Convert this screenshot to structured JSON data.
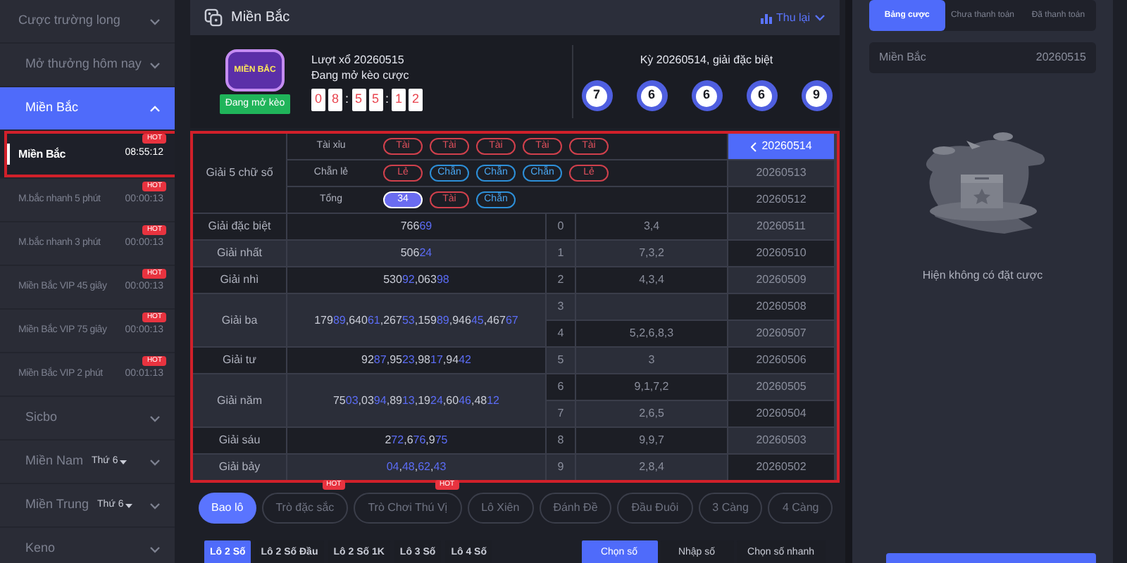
{
  "sidebar": {
    "items": [
      {
        "label": "Cược trường long",
        "expanded": false
      },
      {
        "label": "Mở thưởng hôm nay",
        "expanded": false
      },
      {
        "label": "Miền Bắc",
        "expanded": true,
        "children": [
          {
            "label": "Miền Bắc",
            "time": "08:55:12",
            "badge": "HOT",
            "selected": true,
            "highlighted": true
          },
          {
            "label": "M.bắc nhanh 5 phút",
            "time": "00:00:13",
            "badge": "HOT",
            "selected": false,
            "highlighted": false
          },
          {
            "label": "M.bắc nhanh 3 phút",
            "time": "00:00:13",
            "badge": "HOT",
            "selected": false,
            "highlighted": false
          },
          {
            "label": "Miền Bắc VIP 45 giây",
            "time": "00:00:13",
            "badge": "HOT",
            "selected": false,
            "highlighted": false
          },
          {
            "label": "Miền Bắc VIP 75 giây",
            "time": "00:00:13",
            "badge": "HOT",
            "selected": false,
            "highlighted": false
          },
          {
            "label": "Miền Bắc VIP 2 phút",
            "time": "00:01:13",
            "badge": "HOT",
            "selected": false,
            "highlighted": false
          }
        ]
      },
      {
        "label": "Sicbo",
        "expanded": false
      },
      {
        "label": "Miền Nam",
        "day": "Thứ 6",
        "expanded": false
      },
      {
        "label": "Miền Trung",
        "day": "Thứ 6",
        "expanded": false
      },
      {
        "label": "Keno",
        "expanded": false
      }
    ]
  },
  "header": {
    "title": "Miền Bắc",
    "action": "Thu lại"
  },
  "draw": {
    "logo_text": "MIỀN BẮC",
    "status_badge": "Đang mở kèo",
    "round": "Lượt xổ 20260515",
    "state": "Đang mở kèo cược",
    "countdown": [
      "0",
      "8",
      ":",
      "5",
      "5",
      ":",
      "1",
      "2"
    ],
    "last_title": "Kỳ 20260514, giải đặc biệt",
    "balls": [
      "7",
      "6",
      "6",
      "6",
      "9"
    ]
  },
  "results": {
    "highlighted": true,
    "title": "Giải 5 chữ số",
    "separator": ",",
    "header_rows": [
      {
        "label": "Tài xỉu",
        "pills": [
          {
            "text": "Tài",
            "kind": "over"
          },
          {
            "text": "Tài",
            "kind": "over"
          },
          {
            "text": "Tài",
            "kind": "over"
          },
          {
            "text": "Tài",
            "kind": "over"
          },
          {
            "text": "Tài",
            "kind": "over"
          }
        ]
      },
      {
        "label": "Chẵn lẻ",
        "pills": [
          {
            "text": "Lẻ",
            "kind": "odd"
          },
          {
            "text": "Chẵn",
            "kind": "even"
          },
          {
            "text": "Chẵn",
            "kind": "even"
          },
          {
            "text": "Chẵn",
            "kind": "even"
          },
          {
            "text": "Lẻ",
            "kind": "odd"
          }
        ]
      },
      {
        "label": "Tổng",
        "pills": [
          {
            "text": "34",
            "kind": "total"
          },
          {
            "text": "Tài",
            "kind": "over"
          },
          {
            "text": "Chẵn",
            "kind": "even"
          }
        ]
      }
    ],
    "prizes": [
      {
        "label": "Giải đặc biệt",
        "numbers": [
          {
            "head": "766",
            "tail": "69"
          }
        ]
      },
      {
        "label": "Giải nhất",
        "numbers": [
          {
            "head": "506",
            "tail": "24"
          }
        ]
      },
      {
        "label": "Giải nhì",
        "numbers": [
          {
            "head": "530",
            "tail": "92"
          },
          {
            "head": "063",
            "tail": "98"
          }
        ]
      },
      {
        "label": "Giải ba",
        "numbers": [
          {
            "head": "179",
            "tail": "89"
          },
          {
            "head": "640",
            "tail": "61"
          },
          {
            "head": "267",
            "tail": "53"
          },
          {
            "head": "159",
            "tail": "89"
          },
          {
            "head": "946",
            "tail": "45"
          },
          {
            "head": "467",
            "tail": "67"
          }
        ]
      },
      {
        "label": "Giải tư",
        "numbers": [
          {
            "head": "92",
            "tail": "87"
          },
          {
            "head": "95",
            "tail": "23"
          },
          {
            "head": "98",
            "tail": "17"
          },
          {
            "head": "94",
            "tail": "42"
          }
        ]
      },
      {
        "label": "Giải năm",
        "numbers": [
          {
            "head": "75",
            "tail": "03"
          },
          {
            "head": "03",
            "tail": "94"
          },
          {
            "head": "89",
            "tail": "13"
          },
          {
            "head": "19",
            "tail": "24"
          },
          {
            "head": "60",
            "tail": "46"
          },
          {
            "head": "48",
            "tail": "12"
          }
        ]
      },
      {
        "label": "Giải sáu",
        "numbers": [
          {
            "head": "2",
            "tail": "72"
          },
          {
            "head": "6",
            "tail": "76"
          },
          {
            "head": "9",
            "tail": "75"
          }
        ]
      },
      {
        "label": "Giải bảy",
        "numbers": [
          {
            "tail": "04"
          },
          {
            "tail": "48"
          },
          {
            "tail": "62"
          },
          {
            "tail": "43"
          }
        ]
      }
    ],
    "heads": [
      {
        "digit": "0",
        "tails": "3,4"
      },
      {
        "digit": "1",
        "tails": "7,3,2"
      },
      {
        "digit": "2",
        "tails": "4,3,4"
      },
      {
        "digit": "3"
      },
      {
        "digit": "4",
        "tails": "5,2,6,8,3"
      },
      {
        "digit": "5",
        "tails": "3"
      },
      {
        "digit": "6",
        "tails": "9,1,7,2"
      },
      {
        "digit": "7",
        "tails": "2,6,5"
      },
      {
        "digit": "8",
        "tails": "9,9,7"
      },
      {
        "digit": "9",
        "tails": "2,8,4"
      }
    ],
    "periods": [
      {
        "label": "20260514",
        "selected": true
      },
      {
        "label": "20260513",
        "selected": false
      },
      {
        "label": "20260512",
        "selected": false
      },
      {
        "label": "20260511",
        "selected": false
      },
      {
        "label": "20260510",
        "selected": false
      },
      {
        "label": "20260509",
        "selected": false
      },
      {
        "label": "20260508",
        "selected": false
      },
      {
        "label": "20260507",
        "selected": false
      },
      {
        "label": "20260506",
        "selected": false
      },
      {
        "label": "20260505",
        "selected": false
      },
      {
        "label": "20260504",
        "selected": false
      },
      {
        "label": "20260503",
        "selected": false
      },
      {
        "label": "20260502",
        "selected": false
      }
    ]
  },
  "game_tabs": [
    {
      "label": "Bao lô",
      "selected": true
    },
    {
      "label": "Trò đặc sắc",
      "badge": "HOT",
      "selected": false
    },
    {
      "label": "Trò Chơi Thú Vị",
      "badge": "HOT",
      "selected": false
    },
    {
      "label": "Lô Xiên",
      "selected": false
    },
    {
      "label": "Đánh Đề",
      "selected": false
    },
    {
      "label": "Đầu Đuôi",
      "selected": false
    },
    {
      "label": "3 Càng",
      "selected": false
    },
    {
      "label": "4 Càng",
      "selected": false
    }
  ],
  "bet_types": [
    {
      "label": "Lô 2 Số",
      "selected": true
    },
    {
      "label": "Lô 2 Số Đầu",
      "selected": false
    },
    {
      "label": "Lô 2 Số 1K",
      "selected": false
    },
    {
      "label": "Lô 3 Số",
      "selected": false
    },
    {
      "label": "Lô 4 Số",
      "selected": false
    }
  ],
  "input_modes": [
    {
      "label": "Chọn số",
      "selected": true
    },
    {
      "label": "Nhập số",
      "selected": false
    },
    {
      "label": "Chọn số nhanh",
      "selected": false
    }
  ],
  "bet_panel": {
    "tabs": [
      {
        "label": "Bảng cược",
        "selected": true
      },
      {
        "label": "Chưa thanh toán",
        "selected": false
      },
      {
        "label": "Đã thanh toán",
        "selected": false
      }
    ],
    "game": "Miền Bắc",
    "period": "20260515",
    "empty_text": "Hiện không có đặt cược"
  }
}
